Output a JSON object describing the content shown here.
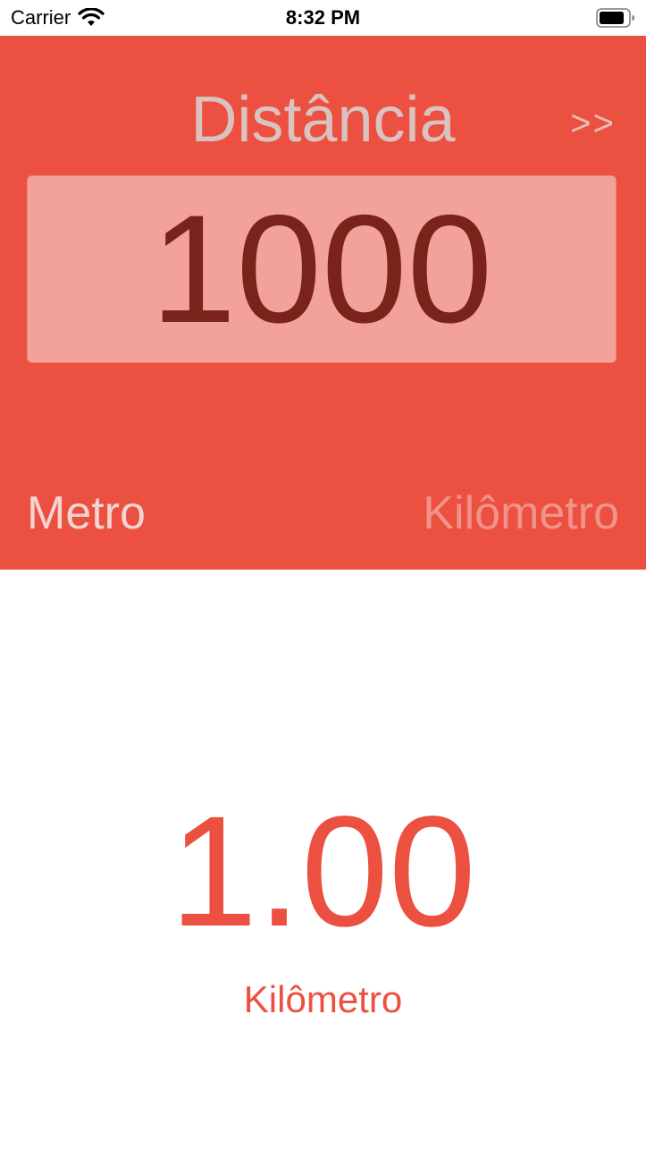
{
  "status_bar": {
    "carrier": "Carrier",
    "time": "8:32 PM"
  },
  "converter": {
    "title": "Distância",
    "next_label": ">>",
    "input_value": "1000",
    "from_unit": "Metro",
    "to_unit": "Kilômetro"
  },
  "result": {
    "value": "1.00",
    "unit": "Kilômetro"
  },
  "colors": {
    "accent": "#ec5040",
    "input_background": "#f2a29a",
    "input_text": "#7a231c",
    "background": "#ffffff"
  },
  "icons": [
    "wifi-icon",
    "battery-icon"
  ]
}
